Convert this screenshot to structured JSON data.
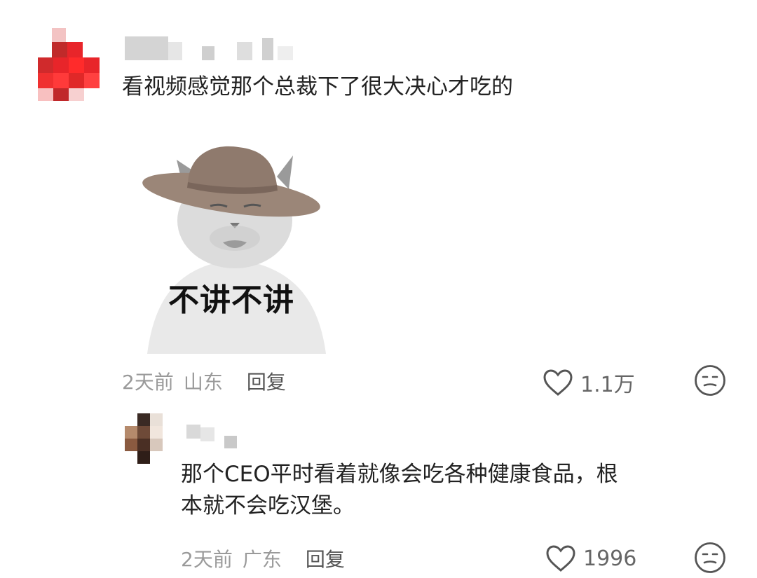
{
  "comments": [
    {
      "text": "看视频感觉那个总裁下了很大决心才吃的",
      "sticker_caption": "不讲不讲",
      "time": "2天前",
      "location": "山东",
      "reply_label": "回复",
      "likes": "1.1万"
    },
    {
      "text": "那个CEO平时看着就像会吃各种健康食品，根\n本就不会吃汉堡。",
      "time": "2天前",
      "location": "广东",
      "reply_label": "回复",
      "likes": "1996"
    }
  ],
  "icons": {
    "like": "heart-outline-icon",
    "reaction": "meh-face-icon"
  },
  "colors": {
    "text": "#222222",
    "meta": "#9a9a9a",
    "reply": "#555555",
    "avatar_red": "#e8252a"
  }
}
